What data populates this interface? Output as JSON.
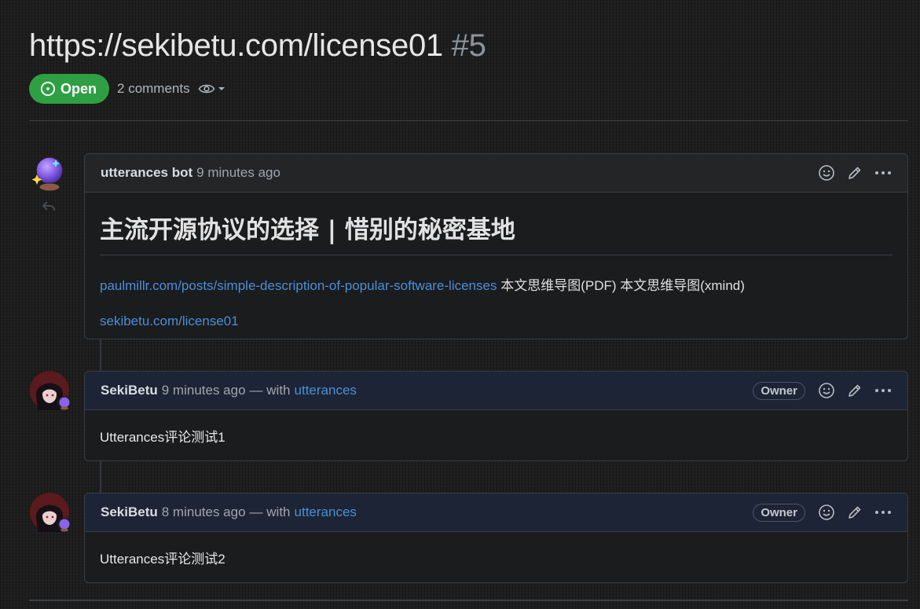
{
  "issue": {
    "title": "https://sekibetu.com/license01",
    "number": "#5",
    "state": "Open",
    "comments": "2 comments"
  },
  "comments": [
    {
      "author": "utterances bot",
      "time": "9 minutes ago",
      "title": "主流开源协议的选择 | 惜别的秘密基地",
      "link1": "paulmillr.com/posts/simple-description-of-popular-software-licenses",
      "text1": " 本文思维导图(PDF) 本文思维导图(xmind)",
      "link2": "sekibetu.com/license01"
    },
    {
      "author": "SekiBetu",
      "time": "9 minutes ago",
      "with_label": "— with",
      "with_link": "utterances",
      "badge": "Owner",
      "body": "Utterances评论测试1"
    },
    {
      "author": "SekiBetu",
      "time": "8 minutes ago",
      "with_label": "— with",
      "with_link": "utterances",
      "badge": "Owner",
      "body": "Utterances评论测试2"
    }
  ],
  "icons": {
    "state": "issue-opened-icon",
    "watch": "eye-icon",
    "dropdown": "caret-down-icon",
    "reaction": "smiley-icon",
    "edit": "pencil-icon",
    "more": "kebab-horizontal-icon",
    "reply": "reply-icon"
  },
  "colors": {
    "open_badge": "#2ea043",
    "link": "#4a8fd8",
    "owner_header": "#1d2435"
  }
}
